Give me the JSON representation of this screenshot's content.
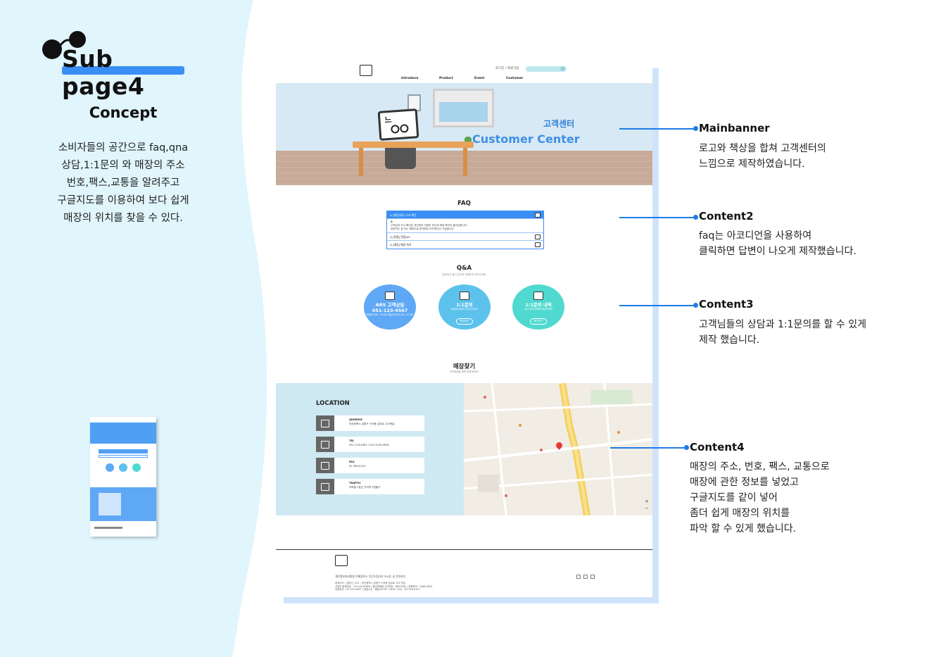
{
  "page": {
    "title": "Sub page4",
    "concept": {
      "heading": "Concept",
      "lines": [
        "소비자들의 공간으로 faq,qna",
        "상담,1:1문의 와 매장의 주소",
        "번호,팩스,교통을 알려주고",
        "구글지도를 이용하여 보다 쉽게",
        "매장의 위치를 찾을 수 있다."
      ]
    }
  },
  "mockup": {
    "top_links": "로그인  /  회원가입",
    "nav": [
      "Introduce",
      "Product",
      "Event",
      "Customer"
    ],
    "banner": {
      "title_ko": "고객센터",
      "title_en": "Customer Center"
    },
    "faq": {
      "title": "FAQ",
      "items": [
        {
          "q": "Q [매장정보] 도서 확인"
        },
        {
          "q": "Q [반품] 반품/AS"
        },
        {
          "q": "Q [매장] 매장 위치"
        }
      ],
      "answer": [
        "A",
        "고객님의 도서 확인은 개인정보 이용후 부산대 매장 확인이 불가능합니다.",
        "방문하신 분 또는 매장으로 문의해주시면 확인이 가능합니다."
      ]
    },
    "qna": {
      "title": "Q&A",
      "subtitle": "궁금하신 점이 있으면 언제든지 문의주세요",
      "cards": [
        {
          "title": "ARS 고객상담",
          "line2": "051-123-4567",
          "sub": "평일09:00~18:00 점심시간12:00~13:00",
          "button": "",
          "color": "#5fa8f5"
        },
        {
          "title": "1:1문의",
          "line2": "",
          "sub": "궁금하신점이 있으신가요?",
          "button": "문의하기",
          "color": "#5cc2ec"
        },
        {
          "title": "1:1문의 내역",
          "line2": "",
          "sub": "지난 문의내역을 확인하세요",
          "button": "확인하기",
          "color": "#4fd9d0"
        }
      ]
    },
    "store": {
      "title": "매장찾기",
      "subtitle": "오프매장을 한번 방문하세요!",
      "location_heading": "LOCATION",
      "items": [
        {
          "label": "ADDRESS",
          "value": "부산광역시 금정구 구서동 금강로 123번길"
        },
        {
          "label": "TEL",
          "value": "051-123-4567 / 010-1234-5678"
        },
        {
          "label": "FAX",
          "value": "02-789-0123"
        },
        {
          "label": "TRAFFIC",
          "value": "지하철 1호선 구서역 1번출구"
        }
      ]
    },
    "footer": {
      "links": "개인정보처리방침    이메일주소 무단수집거부    오시는 길    문의하기",
      "info": [
        "대표이사 : 김부산 | 주소 : 부산광역시 금정구 구서동 금강로 123 번길",
        "사업자 등록번호 : 123-45-67890 | 통신판매업 신고번호 : 제2018호 | 전화문의 : 1588-0000",
        "대표번호 : 02-123-4567 | 영업시간 : 평일 09:00~18:00 | Fax : 02-789-0123"
      ]
    }
  },
  "annotations": [
    {
      "title": "Mainbanner",
      "lines": [
        "로고와 책상을 합쳐 고객센터의",
        "느낌으로 제작하였습니다."
      ]
    },
    {
      "title": "Content2",
      "lines": [
        "faq는 아코디언을 사용하여",
        "클릭하면 답변이 나오게 제작했습니다."
      ]
    },
    {
      "title": "Content3",
      "lines": [
        "고객님들의 상담과 1:1문의를 할 수 있게",
        "제작 했습니다."
      ]
    },
    {
      "title": "Content4",
      "lines": [
        "매장의 주소, 번호, 팩스, 교통으로",
        "매장에 관한 정보를 넣었고",
        "구글지도를 같이 넣어",
        "좀더 쉽게 매장의 위치를",
        "파악 할 수 있게 했습니다."
      ]
    }
  ],
  "colors": {
    "accent": "#1e7be8",
    "left_panel": "#e0f5fc",
    "title_bar": "#3a8ef5"
  }
}
